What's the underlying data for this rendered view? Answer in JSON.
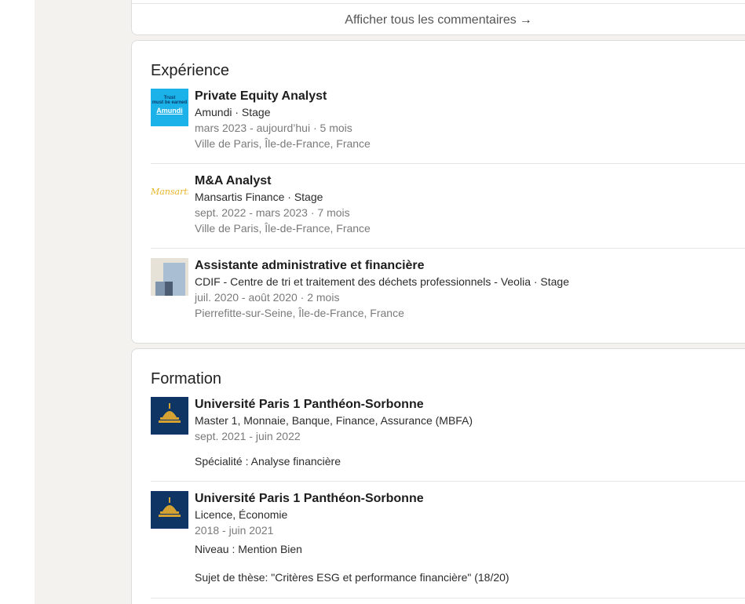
{
  "comments": {
    "show_all_label": "Afficher tous les commentaires",
    "arrow": "→"
  },
  "experience": {
    "title": "Expérience",
    "items": [
      {
        "logo": "amundi-logo",
        "logo_text_top": "Trust\nmust be earned",
        "logo_text": "Amundi",
        "title": "Private Equity Analyst",
        "company": "Amundi · Stage",
        "dates": "mars 2023 - aujourd’hui · 5 mois",
        "location": "Ville de Paris, Île-de-France, France"
      },
      {
        "logo": "mansartis-logo",
        "logo_text": "Mansartis",
        "title": "M&A Analyst",
        "company": "Mansartis Finance · Stage",
        "dates": "sept. 2022 - mars 2023 · 7 mois",
        "location": "Ville de Paris, Île-de-France, France"
      },
      {
        "logo": "veolia-logo",
        "title": "Assistante administrative et financière",
        "company": "CDIF - Centre de tri et traitement des déchets professionnels - Veolia · Stage",
        "dates": "juil. 2020 - août 2020 · 2 mois",
        "location": "Pierrefitte-sur-Seine, Île-de-France, France"
      }
    ]
  },
  "education": {
    "title": "Formation",
    "items": [
      {
        "logo": "sorbonne-logo",
        "school": "Université Paris 1 Panthéon-Sorbonne",
        "degree": "Master 1, Monnaie, Banque, Finance, Assurance (MBFA)",
        "dates": "sept. 2021 - juin 2022",
        "notes": [
          "Spécialité : Analyse financière"
        ]
      },
      {
        "logo": "sorbonne-logo",
        "school": "Université Paris 1 Panthéon-Sorbonne",
        "degree": "Licence, Économie",
        "dates": "2018 - juin 2021",
        "notes": [
          "Niveau : Mention Bien",
          "Sujet de thèse: \"Critères ESG et performance financière\" (18/20)"
        ]
      }
    ]
  },
  "colors": {
    "page_bg": "#f3f2ef",
    "card_bg": "#ffffff",
    "amundi": "#1ab2e8",
    "sorbonne": "#0e3563",
    "sorbonne_gold": "#d3a233"
  }
}
